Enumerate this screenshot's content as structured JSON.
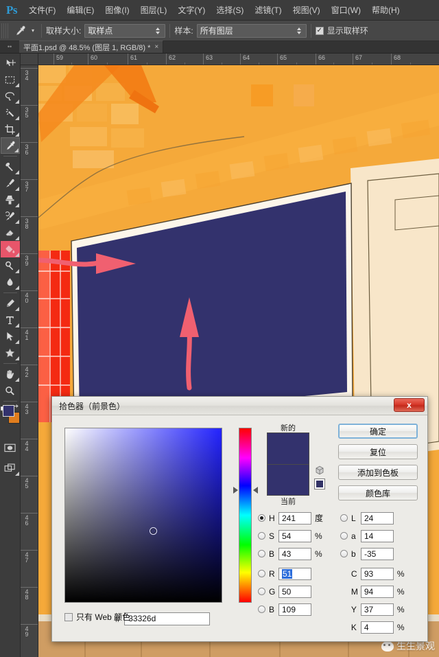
{
  "app": {
    "name": "Ps",
    "logo_color": "#2f9bd6"
  },
  "menubar": {
    "items": [
      {
        "label": "文件(F)"
      },
      {
        "label": "编辑(E)"
      },
      {
        "label": "图像(I)"
      },
      {
        "label": "图层(L)"
      },
      {
        "label": "文字(Y)"
      },
      {
        "label": "选择(S)"
      },
      {
        "label": "滤镜(T)"
      },
      {
        "label": "视图(V)"
      },
      {
        "label": "窗口(W)"
      },
      {
        "label": "帮助(H)"
      }
    ]
  },
  "options_bar": {
    "tool": "eyedropper-tool",
    "sample_size_label": "取样大小:",
    "sample_size_value": "取样点",
    "sample_label": "样本:",
    "sample_value": "所有图层",
    "show_ring_label": "显示取样环",
    "show_ring_checked": true,
    "checkmark": "✓"
  },
  "tabbar": {
    "document_title": "平面1.psd @ 48.5% (图层 1, RGB/8) *",
    "close_glyph": "×"
  },
  "toolbar": {
    "tools": [
      {
        "name": "move-tool",
        "selected": false,
        "has_submenu": false
      },
      {
        "name": "rectangular-marquee-tool",
        "selected": false,
        "has_submenu": true
      },
      {
        "name": "lasso-tool",
        "selected": false,
        "has_submenu": true
      },
      {
        "name": "magic-wand-tool",
        "selected": false,
        "has_submenu": true
      },
      {
        "name": "crop-tool",
        "selected": false,
        "has_submenu": true
      },
      {
        "name": "eyedropper-tool",
        "selected": true,
        "has_submenu": true
      },
      {
        "name": "healing-brush-tool",
        "selected": false,
        "has_submenu": true
      },
      {
        "name": "brush-tool",
        "selected": false,
        "has_submenu": true
      },
      {
        "name": "clone-stamp-tool",
        "selected": false,
        "has_submenu": true
      },
      {
        "name": "history-brush-tool",
        "selected": false,
        "has_submenu": true
      },
      {
        "name": "eraser-tool",
        "selected": false,
        "has_submenu": true
      },
      {
        "name": "paint-bucket-tool",
        "selected": false,
        "has_submenu": true,
        "highlighted": true
      },
      {
        "name": "dodge-tool",
        "selected": false,
        "has_submenu": true
      },
      {
        "name": "blur-tool",
        "selected": false,
        "has_submenu": true
      },
      {
        "name": "pen-tool",
        "selected": false,
        "has_submenu": true
      },
      {
        "name": "horizontal-type-tool",
        "selected": false,
        "has_submenu": true
      },
      {
        "name": "path-selection-tool",
        "selected": false,
        "has_submenu": true
      },
      {
        "name": "custom-shape-tool",
        "selected": false,
        "has_submenu": true
      },
      {
        "name": "hand-tool",
        "selected": false,
        "has_submenu": true
      },
      {
        "name": "zoom-tool",
        "selected": false,
        "has_submenu": false
      }
    ],
    "foreground_color": "#33326d",
    "background_color": "#e07d1e",
    "quick_mask_name": "quick-mask-button",
    "screen_mode_name": "screen-mode-button"
  },
  "rulers": {
    "unit": "m",
    "horizontal_ticks": [
      "59",
      "60",
      "61",
      "62",
      "63",
      "64",
      "65",
      "66",
      "67",
      "68"
    ],
    "vertical_ticks": [
      "34",
      "35",
      "36",
      "37",
      "38",
      "39",
      "40",
      "41",
      "42",
      "43",
      "44",
      "45",
      "46",
      "47",
      "48",
      "49"
    ]
  },
  "canvas": {
    "description": "landscape-site-plan",
    "colors": {
      "orange_bg": "#f5a93a",
      "orange_dark": "#f07e18",
      "navy_block": "#33326d",
      "cream": "#f6e2c3",
      "red_block": "#f42a12",
      "bottom_sand": "#cf9d63"
    },
    "annotations": [
      {
        "name": "arrow-to-paint-bucket",
        "direction": "right"
      },
      {
        "name": "arrow-to-foreground-swatch",
        "direction": "up"
      }
    ]
  },
  "dialog": {
    "title": "拾色器（前景色）",
    "close_label": "x",
    "buttons": [
      {
        "label": "确定",
        "name": "ok-button",
        "primary": true
      },
      {
        "label": "复位",
        "name": "reset-button",
        "primary": false
      },
      {
        "label": "添加到色板",
        "name": "add-to-swatches-button",
        "primary": false
      },
      {
        "label": "颜色库",
        "name": "color-libraries-button",
        "primary": false
      }
    ],
    "preview": {
      "new_label": "新的",
      "current_label": "当前",
      "new_color": "#33326d",
      "current_color": "#33326d",
      "websafe_color": "#333366"
    },
    "hsb": [
      {
        "key": "H",
        "value": "241",
        "unit": "度",
        "selected": true
      },
      {
        "key": "S",
        "value": "54",
        "unit": "%",
        "selected": false
      },
      {
        "key": "B",
        "value": "43",
        "unit": "%",
        "selected": false
      }
    ],
    "lab": [
      {
        "key": "L",
        "value": "24",
        "unit": "",
        "selected": false
      },
      {
        "key": "a",
        "value": "14",
        "unit": "",
        "selected": false
      },
      {
        "key": "b",
        "value": "-35",
        "unit": "",
        "selected": false
      }
    ],
    "rgb": [
      {
        "key": "R",
        "value": "51",
        "unit": "",
        "selected": false,
        "highlighted": true
      },
      {
        "key": "G",
        "value": "50",
        "unit": "",
        "selected": false,
        "highlighted": false
      },
      {
        "key": "B",
        "value": "109",
        "unit": "",
        "selected": false,
        "highlighted": false
      }
    ],
    "cmyk": [
      {
        "key": "C",
        "value": "93",
        "unit": "%"
      },
      {
        "key": "M",
        "value": "94",
        "unit": "%"
      },
      {
        "key": "Y",
        "value": "37",
        "unit": "%"
      },
      {
        "key": "K",
        "value": "4",
        "unit": "%"
      }
    ],
    "hex_symbol": "#",
    "hex_value": "33326d",
    "web_only_label": "只有 Web 颜色",
    "web_only_checked": false,
    "field": {
      "hue_css": "#2323ff",
      "marker_left_pct": 54,
      "marker_top_pct": 57
    }
  },
  "watermark": {
    "text": "生生景观"
  }
}
